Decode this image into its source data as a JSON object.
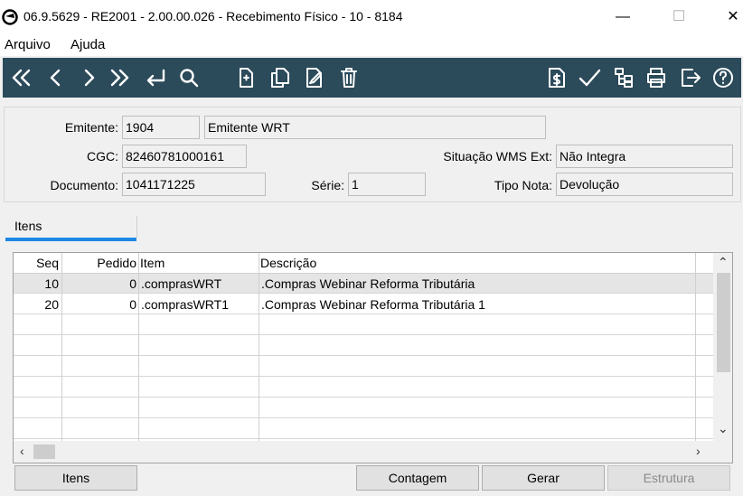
{
  "window": {
    "title": "06.9.5629 - RE2001 - 2.00.00.026 - Recebimento Físico - 10 - 8184",
    "minimize": "—",
    "maximize": "☐",
    "close": "✕"
  },
  "menu": {
    "arquivo": "Arquivo",
    "ajuda": "Ajuda"
  },
  "toolbar": {
    "icons": [
      "first-icon",
      "previous-icon",
      "next-icon",
      "last-icon",
      "goto-icon",
      "search-icon",
      "new-icon",
      "copy-icon",
      "edit-icon",
      "delete-icon",
      "document-value-icon",
      "confirm-icon",
      "tree-icon",
      "print-icon",
      "exit-icon",
      "help-icon"
    ]
  },
  "header": {
    "emitente_label": "Emitente:",
    "emitente_code": "1904",
    "emitente_name": "Emitente WRT",
    "cgc_label": "CGC:",
    "cgc_value": "82460781000161",
    "situacao_label": "Situação WMS Ext:",
    "situacao_value": "Não Integra",
    "documento_label": "Documento:",
    "documento_value": "1041171225",
    "serie_label": "Série:",
    "serie_value": "1",
    "tipo_nota_label": "Tipo Nota:",
    "tipo_nota_value": "Devolução"
  },
  "tabs": {
    "itens": "Itens"
  },
  "grid": {
    "columns": [
      "Seq",
      "Pedido",
      "Item",
      "Descrição"
    ],
    "rows": [
      {
        "seq": "10",
        "pedido": "0",
        "item": ".comprasWRT",
        "descricao": ".Compras Webinar Reforma Tributária"
      },
      {
        "seq": "20",
        "pedido": "0",
        "item": ".comprasWRT1",
        "descricao": ".Compras Webinar Reforma Tributária 1"
      }
    ]
  },
  "buttons": {
    "itens": "Itens",
    "contagem": "Contagem",
    "gerar": "Gerar",
    "estrutura": "Estrutura"
  },
  "colors": {
    "toolbar": "#2b4a5a",
    "tab_accent": "#1e88e5"
  }
}
